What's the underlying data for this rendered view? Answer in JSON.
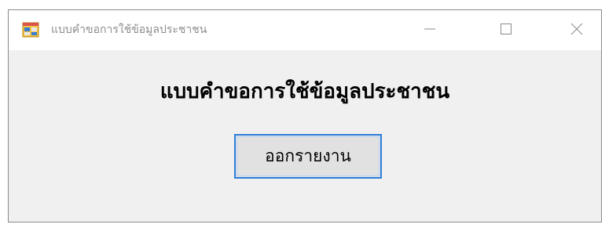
{
  "window": {
    "title": "แบบคำขอการใช้ข้อมูลประชาชน",
    "icon": "windows-form-icon",
    "controls": {
      "minimize_icon": "minimize-icon",
      "maximize_icon": "maximize-icon",
      "close_icon": "close-icon"
    }
  },
  "main": {
    "heading": "แบบคำขอการใช้ข้อมูลประชาชน",
    "report_button_label": "ออกรายงาน"
  },
  "colors": {
    "client_background": "#f0f0f0",
    "button_focus_border": "#2f7ed8",
    "button_background": "#e1e1e1",
    "title_text": "#8c8c8c"
  }
}
